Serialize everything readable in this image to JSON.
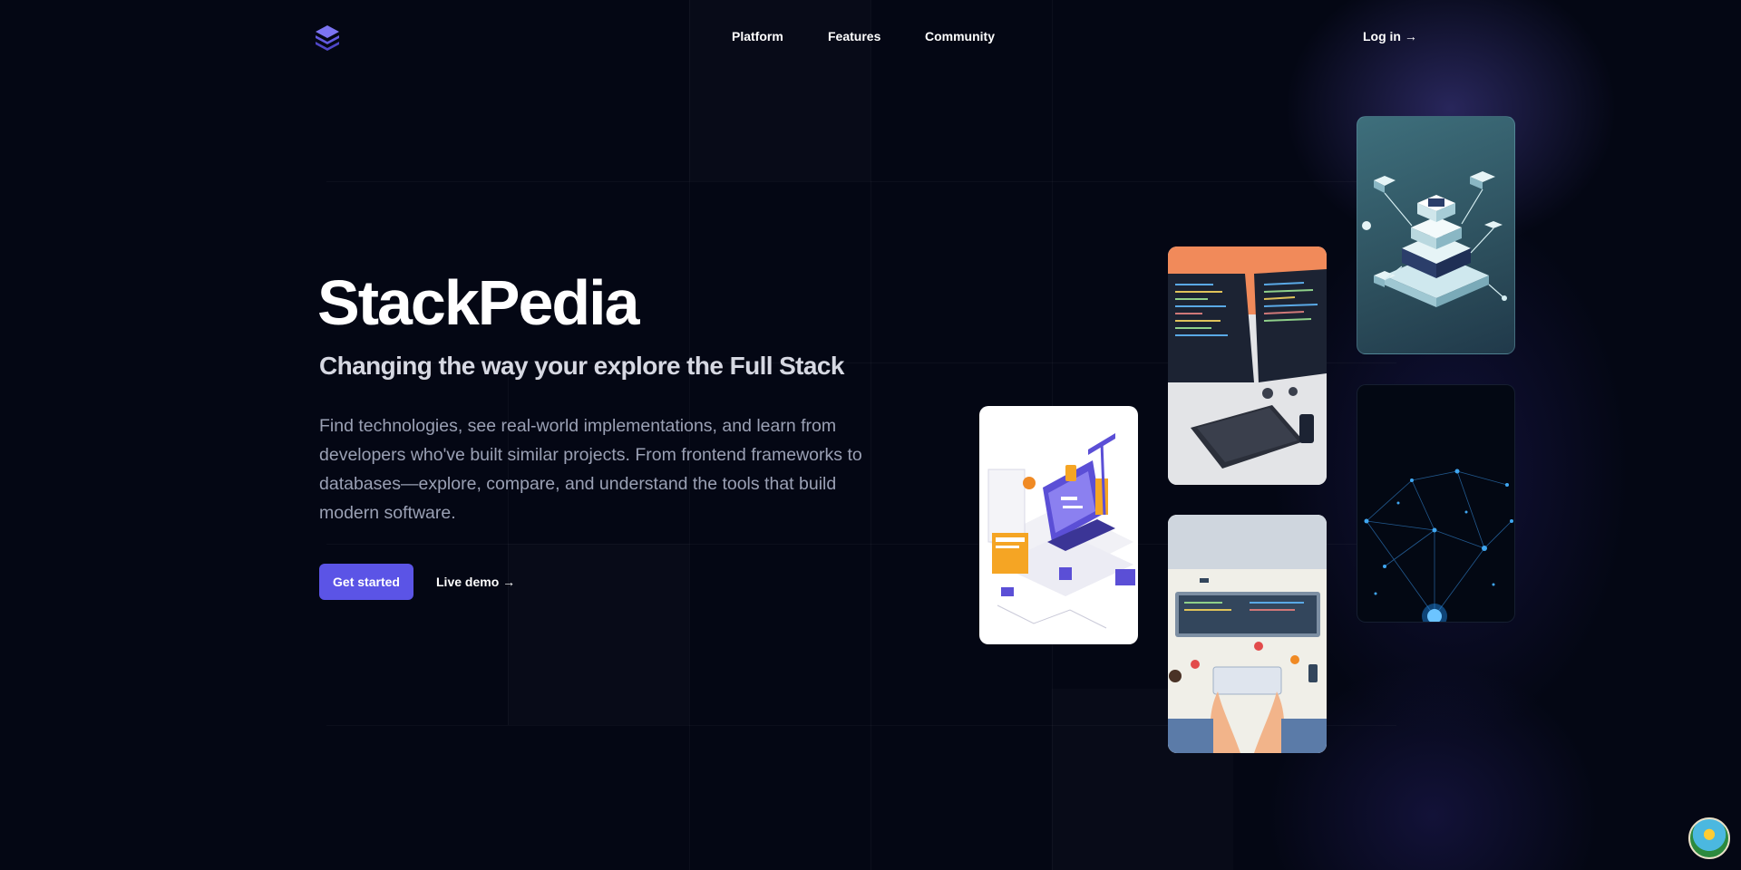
{
  "brand": {
    "logo_icon": "stack-layers-icon",
    "accent": "#5b54e6"
  },
  "nav": {
    "items": [
      {
        "label": "Platform"
      },
      {
        "label": "Features"
      },
      {
        "label": "Community"
      }
    ],
    "login_label": "Log in →"
  },
  "hero": {
    "title": "StackPedia",
    "subtitle": "Changing the way your explore the Full Stack",
    "description": "Find technologies, see real-world implementations, and learn from developers who've built similar projects. From frontend frameworks to databases—explore, compare, and understand the tools that build modern software.",
    "primary_cta": "Get started",
    "secondary_cta": "Live demo →"
  },
  "gallery": {
    "images": [
      {
        "subject": "isometric-dev-workspace-illustration"
      },
      {
        "subject": "dual-monitor-code-desk"
      },
      {
        "subject": "top-down-laptop-typing"
      },
      {
        "subject": "isometric-server-stack"
      },
      {
        "subject": "blue-network-nodes"
      }
    ]
  },
  "floating_avatar": {
    "icon": "beach-avatar-icon"
  }
}
